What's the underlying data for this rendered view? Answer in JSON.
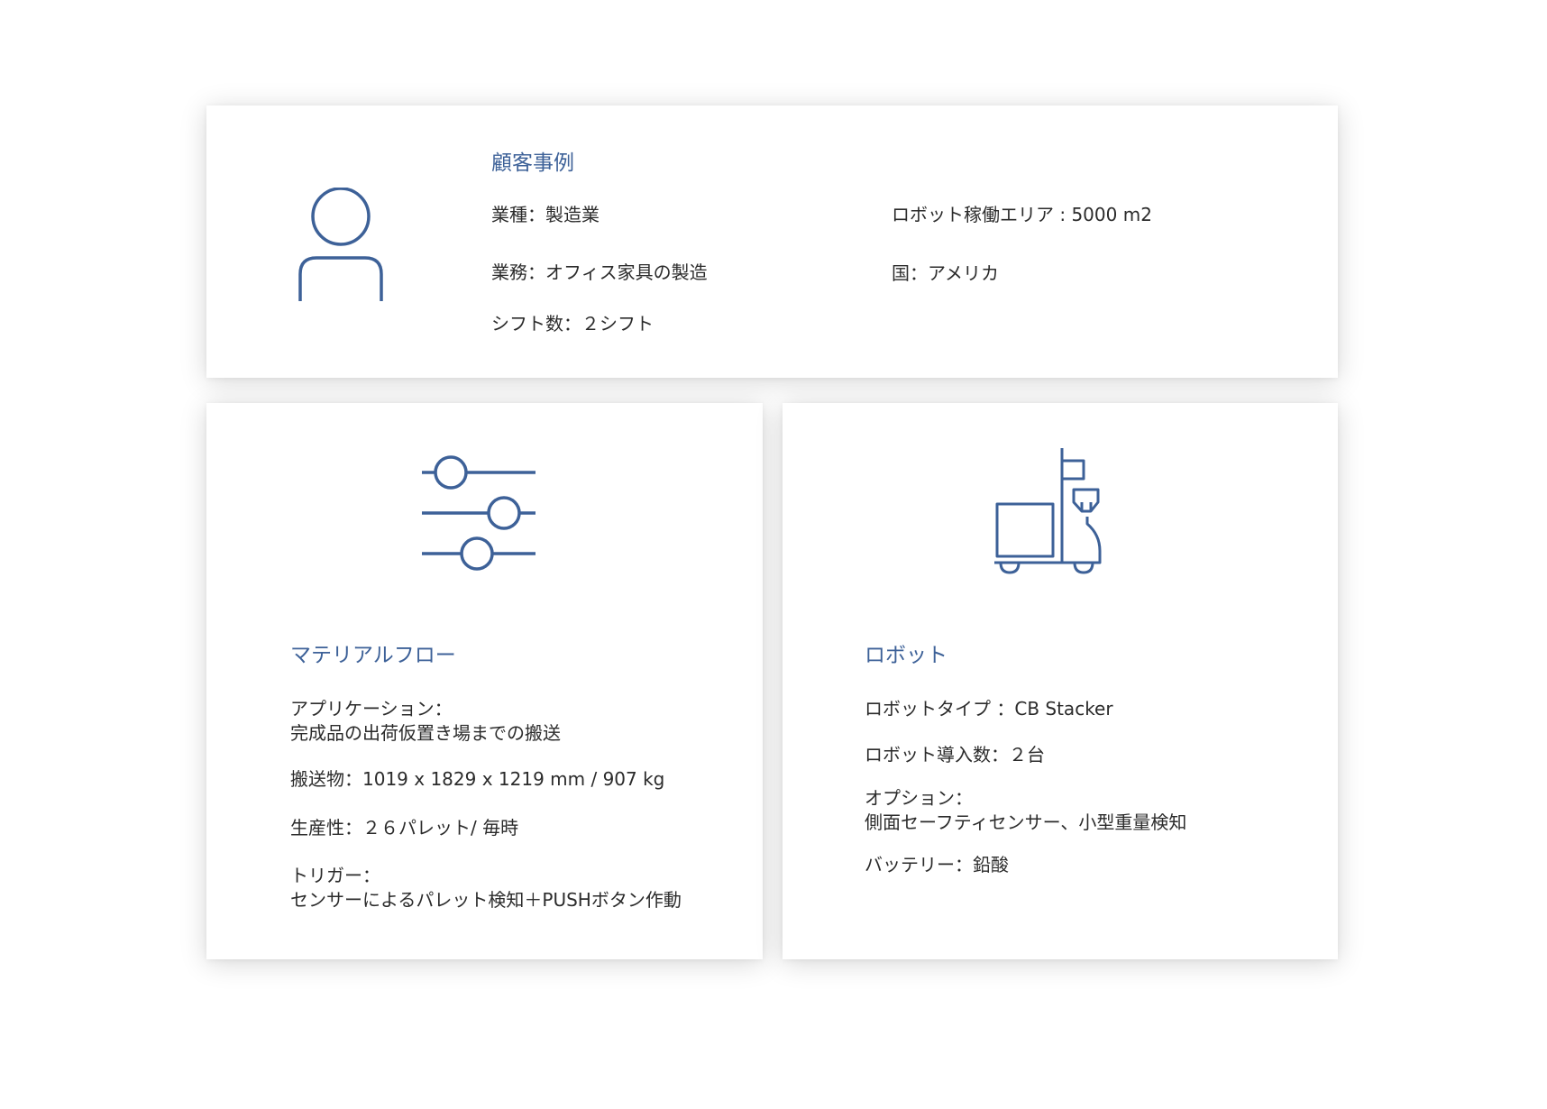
{
  "customer": {
    "title": "顧客事例",
    "icon": "person-icon",
    "industry": "業種：製造業",
    "business": "業務：オフィス家具の製造",
    "shifts": "シフト数：２シフト",
    "area": "ロボット稼働エリア : 5000 m2",
    "country": "国：アメリカ"
  },
  "material_flow": {
    "title": "マテリアルフロー",
    "icon": "sliders-icon",
    "application_label": "アプリケーション：",
    "application_value": "完成品の出荷仮置き場までの搬送",
    "payload": "搬送物：1019 x 1829 x 1219 mm / 907 kg",
    "productivity": "生産性：２６パレット/ 毎時",
    "trigger_label": "トリガー：",
    "trigger_value": "センサーによるパレット検知＋PUSHボタン作動"
  },
  "robot": {
    "title": "ロボット",
    "icon": "forklift-robot-icon",
    "type": "ロボットタイプ ：CB Stacker",
    "count": "ロボット導入数：２台",
    "option_label": "オプション：",
    "option_value": "側面セーフティセンサー、小型重量検知",
    "battery": "バッテリー：鉛酸"
  },
  "colors": {
    "accent": "#3d6198",
    "text": "#2b2b2b",
    "background": "#ffffff"
  }
}
